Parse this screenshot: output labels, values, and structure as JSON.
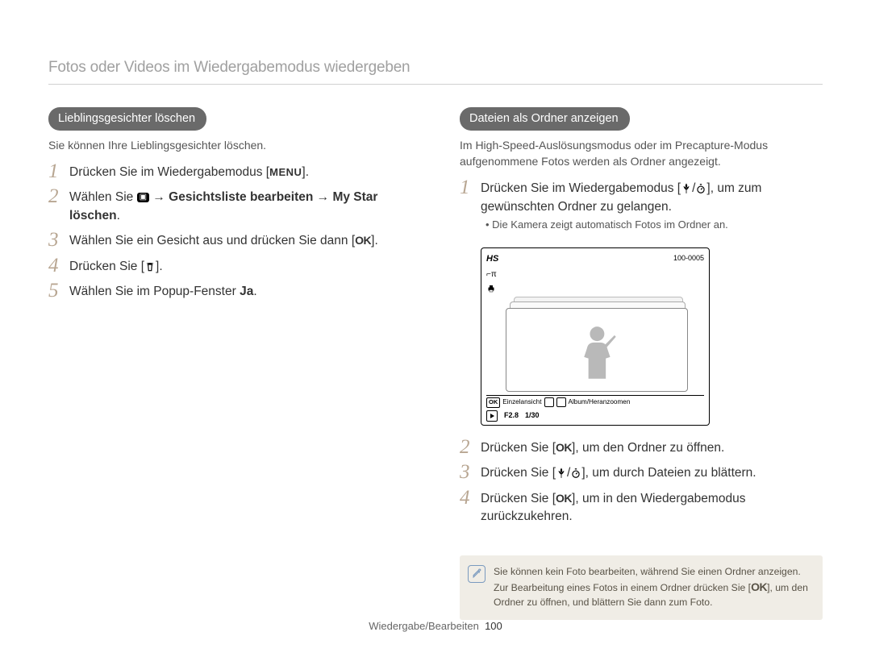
{
  "section_title": "Fotos oder Videos im Wiedergabemodus wiedergeben",
  "left": {
    "heading": "Lieblingsgesichter löschen",
    "intro": "Sie können Ihre Lieblingsgesichter löschen.",
    "steps": {
      "s1_pre": "Drücken Sie im Wiedergabemodus [",
      "s1_key": "MENU",
      "s1_post": "].",
      "s2_pre": "Wählen Sie ",
      "s2_arrow": " → ",
      "s2_bold1": "Gesichtsliste bearbeiten",
      "s2_arrow2": " → ",
      "s2_bold2": "My Star löschen",
      "s2_post": ".",
      "s3_pre": "Wählen Sie ein Gesicht aus und drücken Sie dann [",
      "s3_key": "OK",
      "s3_post": "].",
      "s4_pre": "Drücken Sie [",
      "s4_post": "].",
      "s5_pre": "Wählen Sie im Popup-Fenster ",
      "s5_bold": "Ja",
      "s5_post": "."
    }
  },
  "right": {
    "heading": "Dateien als Ordner anzeigen",
    "intro": "Im High-Speed-Auslösungsmodus oder im Precapture-Modus aufgenommene Fotos werden als Ordner angezeigt.",
    "steps": {
      "s1_pre": "Drücken Sie im Wiedergabemodus [",
      "s1_slash": "/",
      "s1_mid": "], um zum gewünschten Ordner zu gelangen.",
      "s1_sub": "Die Kamera zeigt automatisch Fotos im Ordner an.",
      "s2_pre": "Drücken Sie [",
      "s2_key": "OK",
      "s2_post": "], um den Ordner zu öffnen.",
      "s3_pre": "Drücken Sie [",
      "s3_slash": "/",
      "s3_post": "], um durch Dateien zu blättern.",
      "s4_pre": "Drücken Sie [",
      "s4_key": "OK",
      "s4_post": "], um in den Wiedergabemodus zurückzukehren."
    },
    "folder": {
      "hs": "HS",
      "id": "100-0005",
      "bar_ok": "OK",
      "bar_single": "Einzelansicht",
      "bar_zoom": "Album/Heranzoomen",
      "f": "F2.8",
      "shutter": "1/30"
    },
    "note_pre": "Sie können kein Foto bearbeiten, während Sie einen Ordner anzeigen. Zur Bearbeitung eines Fotos in einem Ordner drücken Sie [",
    "note_key": "OK",
    "note_post": "], um den Ordner zu öffnen, und blättern Sie dann zum Foto."
  },
  "footer": {
    "label": "Wiedergabe/Bearbeiten",
    "page": "100"
  }
}
